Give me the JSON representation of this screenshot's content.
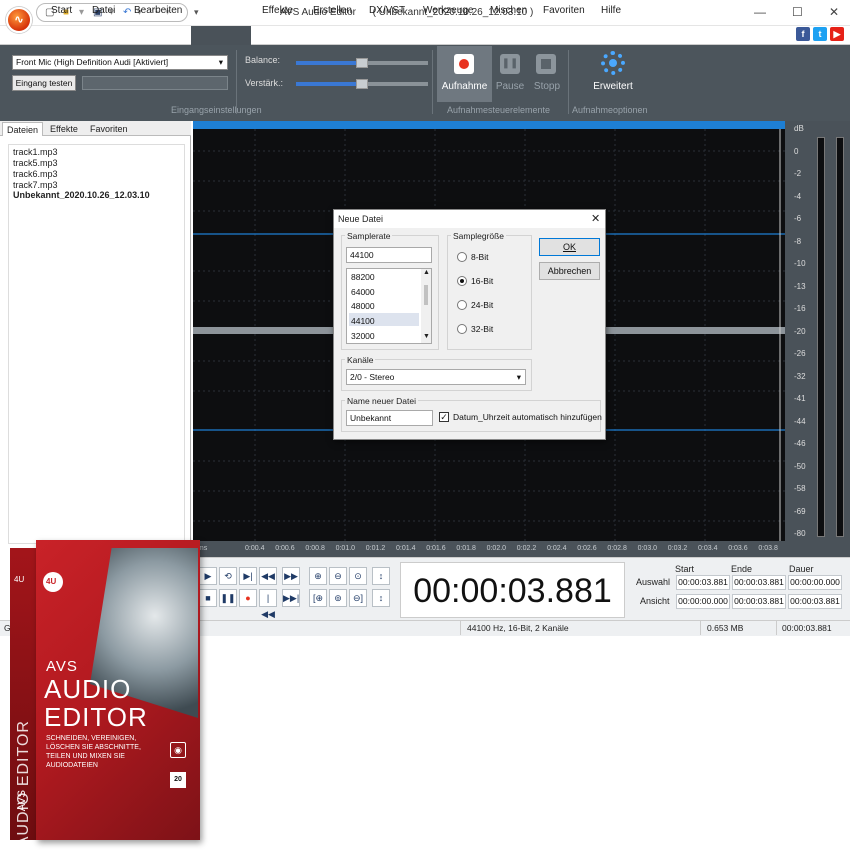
{
  "window": {
    "app_title": "AVS Audio Editor",
    "doc_title": "( Unbekannt_2020.10.26_12.03.10 )",
    "minimize": "—",
    "maximize": "☐",
    "close": "✕",
    "qat_dropdown": "▾"
  },
  "menu": [
    "Start",
    "Datei",
    "Bearbeiten",
    "Aufnahme",
    "Effekte",
    "Erstellen",
    "DX/VST",
    "Werkzeuge",
    "Mischen",
    "Favoriten",
    "Hilfe"
  ],
  "ribbon": {
    "device": "Front Mic (High Definition Audi [Aktiviert]",
    "test_input": "Eingang testen",
    "balance": "Balance:",
    "balance_level": 0.5,
    "gain": "Verstärk.:",
    "gain_level": 0.5,
    "record": "Aufnahme",
    "pause": "Pause",
    "stop": "Stopp",
    "advanced": "Erweitert",
    "group_input": "Eingangseinstellungen",
    "group_record": "Aufnahmesteuerelemente",
    "group_options": "Aufnahmeoptionen"
  },
  "left_panel": {
    "tabs": [
      "Dateien",
      "Effekte",
      "Favoriten"
    ],
    "files": [
      "track1.mp3",
      "track5.mp3",
      "track6.mp3",
      "track7.mp3",
      "Unbekannt_2020.10.26_12.03.10"
    ]
  },
  "waveform": {
    "db_ticks": [
      "dB",
      "0",
      "-2",
      "-4",
      "-6",
      "-8",
      "-10",
      "-13",
      "-16",
      "-20",
      "-26",
      "-32",
      "-41",
      "-44",
      "-46",
      "-50",
      "-58",
      "-69",
      "-80"
    ],
    "time_ticks": [
      "hms",
      "0:00.4",
      "0:00.6",
      "0:00.8",
      "0:01.0",
      "0:01.2",
      "0:01.4",
      "0:01.6",
      "0:01.8",
      "0:02.0",
      "0:02.2",
      "0:02.4",
      "0:02.6",
      "0:02.8",
      "0:03.0",
      "0:03.2",
      "0:03.4",
      "0:03.6",
      "0:03.8"
    ]
  },
  "transport": {
    "time": "00:00:03.881",
    "col_start": "Start",
    "col_end": "Ende",
    "col_duration": "Dauer",
    "row_selection": "Auswahl",
    "row_view": "Ansicht",
    "selection": [
      "00:00:03.881",
      "00:00:03.881",
      "00:00:00.000"
    ],
    "view": [
      "00:00:00.000",
      "00:00:03.881",
      "00:00:03.881"
    ]
  },
  "status": {
    "left": "Ge",
    "format": "44100 Hz, 16-Bit, 2 Kanäle",
    "size": "0.653 MB",
    "duration": "00:00:03.881"
  },
  "dialog": {
    "title": "Neue Datei",
    "close": "✕",
    "samplerate_label": "Samplerate",
    "samplerate_value": "44100",
    "rates": [
      "88200",
      "64000",
      "48000",
      "44100",
      "32000"
    ],
    "selected_rate": "44100",
    "samplesize_label": "Samplegröße",
    "sizes": [
      "8-Bit",
      "16-Bit",
      "24-Bit",
      "32-Bit"
    ],
    "selected_size": "16-Bit",
    "ok": "OK",
    "cancel": "Abbrechen",
    "channels_label": "Kanäle",
    "channels_value": "2/0 - Stereo",
    "name_label": "Name neuer Datei",
    "name_value": "Unbekannt",
    "auto_datetime": "Datum_Uhrzeit automatisch hinzufügen",
    "auto_datetime_checked": true
  },
  "box_art": {
    "brand": "AVS",
    "title1": "AUDIO",
    "title2": "EDITOR",
    "spine": "AUDIO EDITOR",
    "spine_brand": "AVS",
    "tagline": "SCHNEIDEN, VEREINIGEN, LÖSCHEN SIE ABSCHNITTE, TEILEN UND MIXEN SIE AUDIODATEIEN",
    "badge": "20"
  },
  "colors": {
    "accent_blue": "#1e7fd4",
    "record_red": "#e8321f",
    "ribbon": "#4c555c",
    "box_red": "#c92228"
  }
}
